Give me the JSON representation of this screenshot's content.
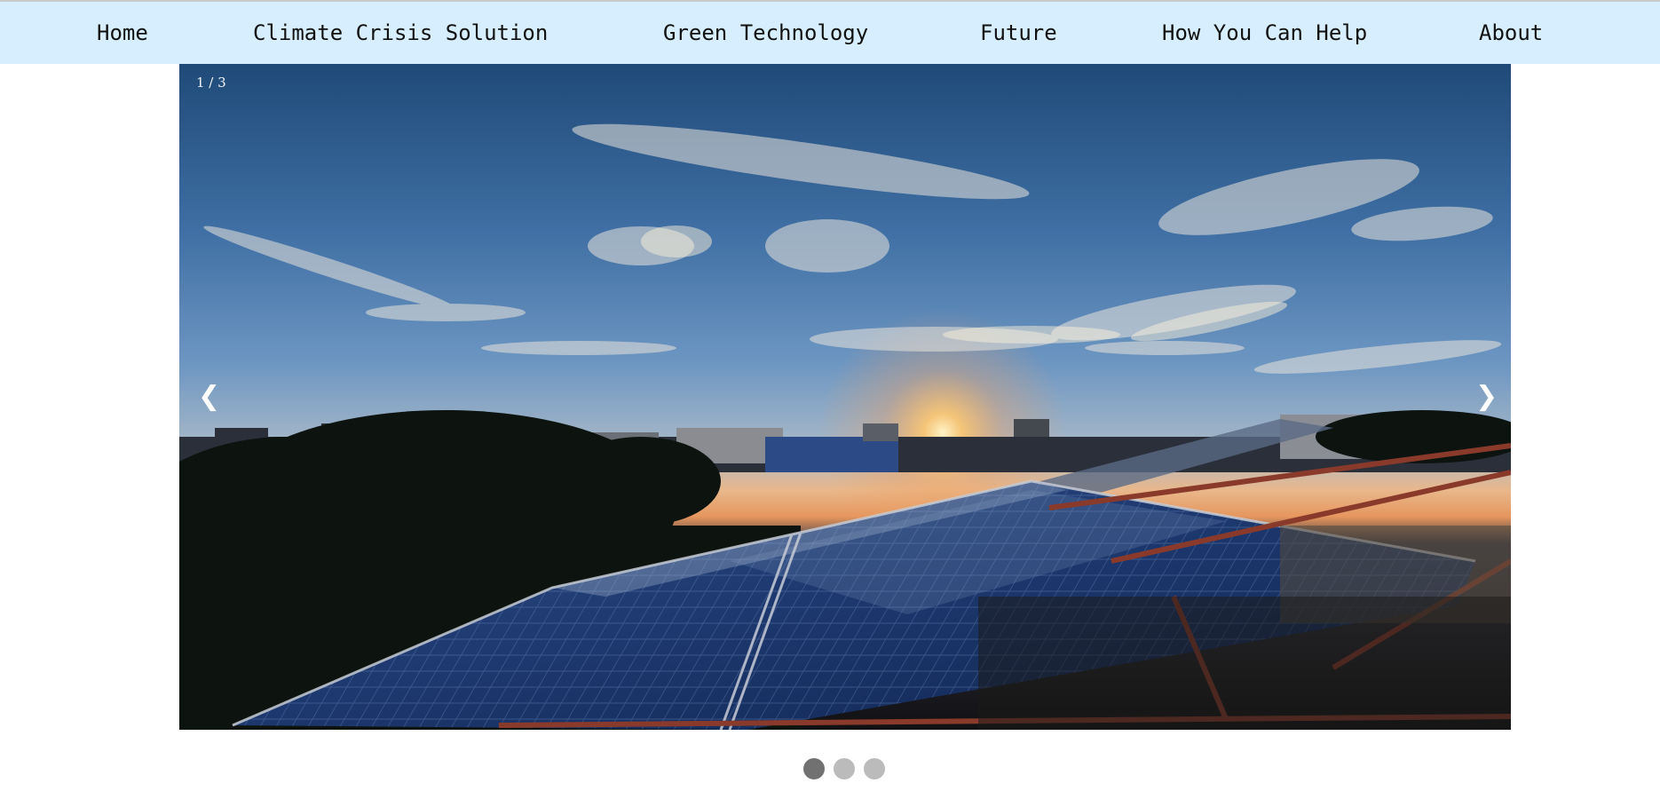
{
  "nav": {
    "items": [
      {
        "label": "Home"
      },
      {
        "label": "Climate Crisis Solution"
      },
      {
        "label": "Green Technology"
      },
      {
        "label": "Future"
      },
      {
        "label": "How You Can Help"
      },
      {
        "label": "About"
      }
    ]
  },
  "slideshow": {
    "counter": "1 / 3",
    "prev_arrow": "❮",
    "next_arrow": "❯",
    "current_slide": 1,
    "total_slides": 3,
    "image_subject": "Rooftop solar panels at sunset over a city skyline"
  },
  "colors": {
    "nav_background": "#d6eefd",
    "dot_active": "#717171",
    "dot_inactive": "#bbbbbb"
  }
}
